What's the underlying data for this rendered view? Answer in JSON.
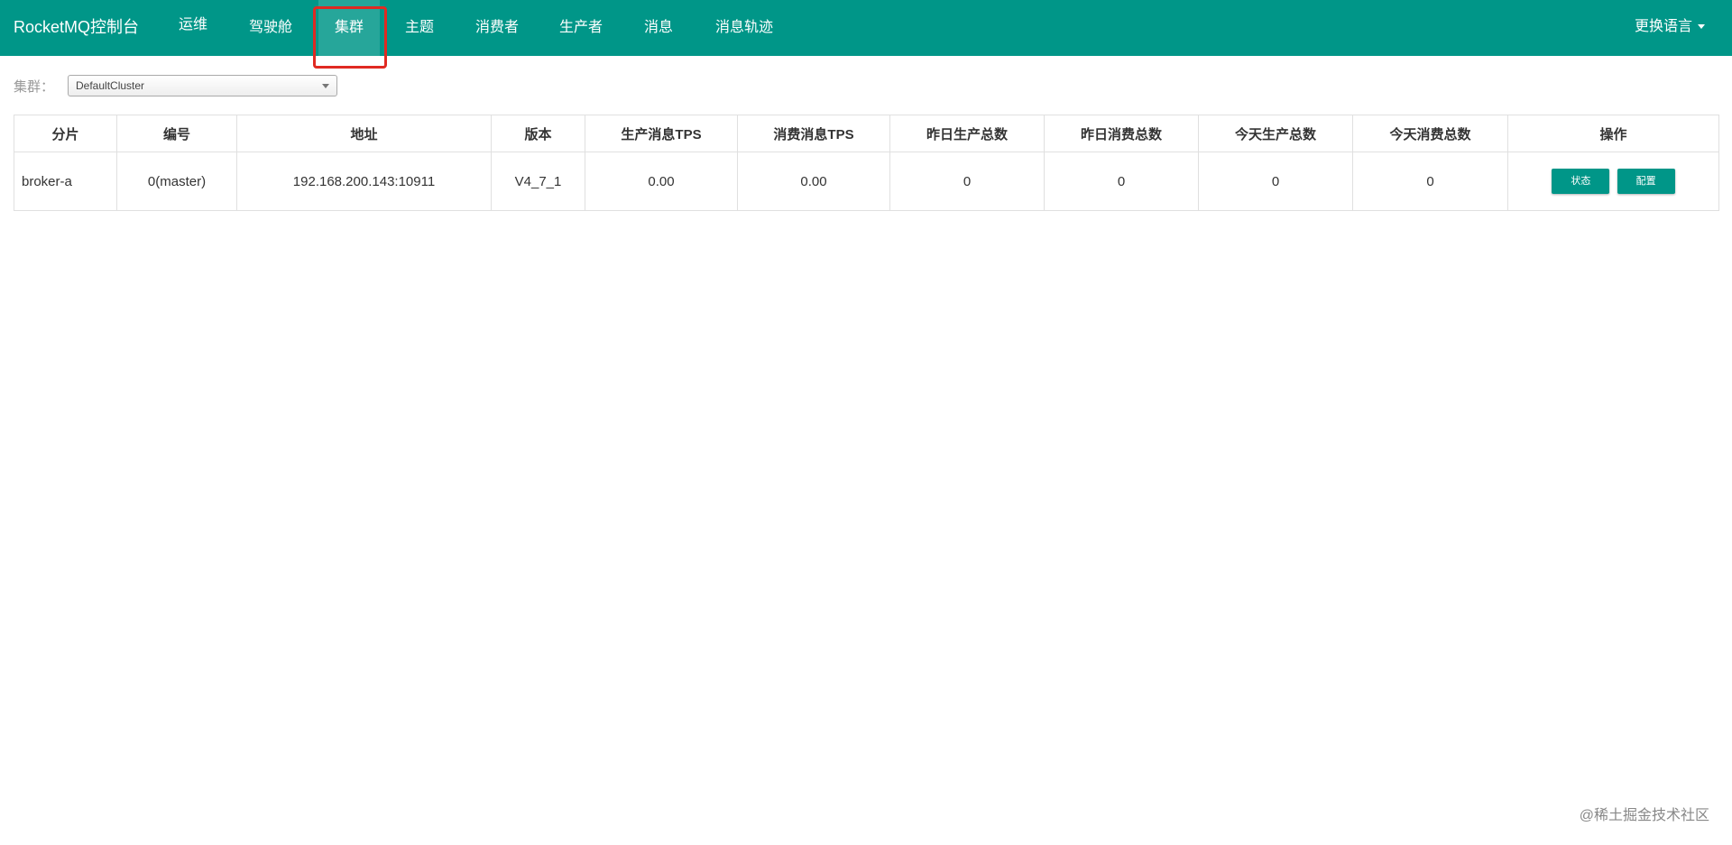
{
  "app": {
    "brand": "RocketMQ控制台",
    "language_label": "更换语言",
    "nav": [
      {
        "label": "运维"
      },
      {
        "label": "驾驶舱"
      },
      {
        "label": "集群"
      },
      {
        "label": "主题"
      },
      {
        "label": "消费者"
      },
      {
        "label": "生产者"
      },
      {
        "label": "消息"
      },
      {
        "label": "消息轨迹"
      }
    ],
    "active_nav": "集群"
  },
  "cluster": {
    "label": "集群：",
    "selected": "DefaultCluster"
  },
  "table": {
    "headers": [
      "分片",
      "编号",
      "地址",
      "版本",
      "生产消息TPS",
      "消费消息TPS",
      "昨日生产总数",
      "昨日消费总数",
      "今天生产总数",
      "今天消费总数",
      "操作"
    ],
    "rows": [
      {
        "shard": "broker-a",
        "id": "0(master)",
        "address": "192.168.200.143:10911",
        "version": "V4_7_1",
        "produce_tps": "0.00",
        "consume_tps": "0.00",
        "yesterday_produce": "0",
        "yesterday_consume": "0",
        "today_produce": "0",
        "today_consume": "0",
        "actions": [
          "状态",
          "配置"
        ]
      }
    ]
  },
  "watermark": "@稀土掘金技术社区",
  "colors": {
    "navbar": "#009688",
    "active_nav": "#26a69a",
    "highlight_box": "#e02a22",
    "button": "#009688"
  }
}
